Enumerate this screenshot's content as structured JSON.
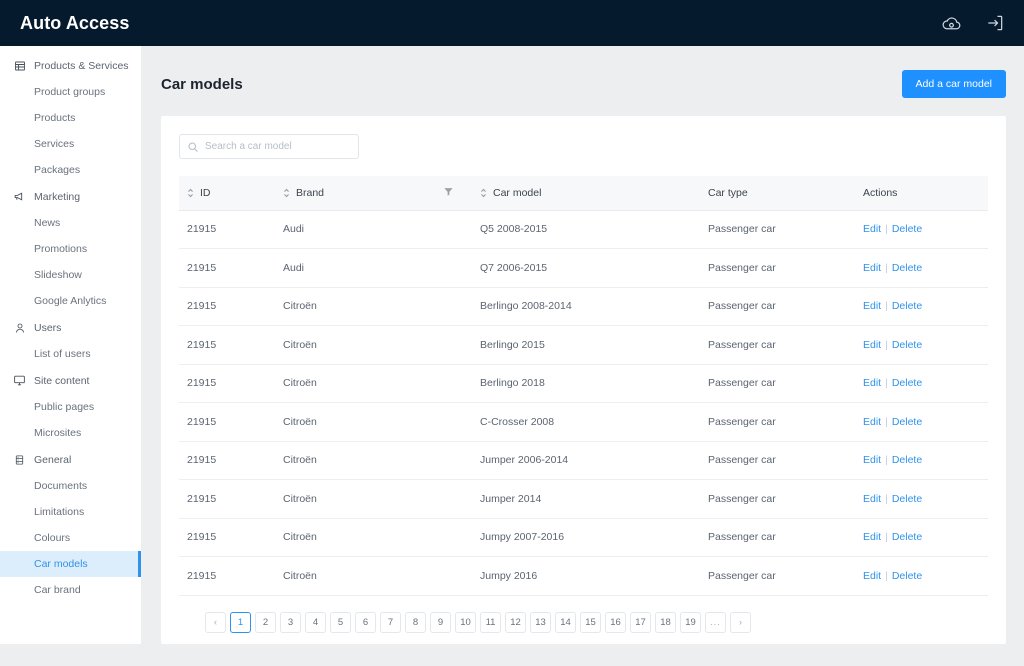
{
  "topbar": {
    "brand": "Auto Access",
    "icons": [
      {
        "name": "cloud-icon",
        "glyph": "cloud"
      },
      {
        "name": "logout-icon",
        "glyph": "logout"
      }
    ]
  },
  "sidebar": {
    "groups": [
      {
        "label": "Products & Services",
        "icon": "grid-table-icon",
        "items": [
          {
            "label": "Product groups",
            "active": false
          },
          {
            "label": "Products",
            "active": false
          },
          {
            "label": "Services",
            "active": false
          },
          {
            "label": "Packages",
            "active": false
          }
        ]
      },
      {
        "label": "Marketing",
        "icon": "megaphone-icon",
        "items": [
          {
            "label": "News",
            "active": false
          },
          {
            "label": "Promotions",
            "active": false
          },
          {
            "label": "Slideshow",
            "active": false
          },
          {
            "label": "Google Anlytics",
            "active": false
          }
        ]
      },
      {
        "label": "Users",
        "icon": "user-icon",
        "items": [
          {
            "label": "List of users",
            "active": false
          }
        ]
      },
      {
        "label": "Site content",
        "icon": "monitor-icon",
        "items": [
          {
            "label": "Public pages",
            "active": false
          },
          {
            "label": "Microsites",
            "active": false
          }
        ]
      },
      {
        "label": "General",
        "icon": "server-icon",
        "items": [
          {
            "label": "Documents",
            "active": false
          },
          {
            "label": "Limitations",
            "active": false
          },
          {
            "label": "Colours",
            "active": false
          },
          {
            "label": "Car models",
            "active": true
          },
          {
            "label": "Car brand",
            "active": false
          }
        ]
      }
    ]
  },
  "main": {
    "page_title": "Car models",
    "add_button": "Add a car model",
    "search": {
      "placeholder": "Search a car model",
      "value": ""
    },
    "table": {
      "columns": [
        {
          "label": "ID",
          "sortable": true,
          "filter": false
        },
        {
          "label": "Brand",
          "sortable": true,
          "filter": true
        },
        {
          "label": "Car model",
          "sortable": true,
          "filter": false
        },
        {
          "label": "Car type",
          "sortable": false,
          "filter": false
        },
        {
          "label": "Actions",
          "sortable": false,
          "filter": false
        }
      ],
      "actions": {
        "edit": "Edit",
        "delete": "Delete",
        "separator": "|"
      },
      "rows": [
        {
          "id": "21915",
          "brand": "Audi",
          "model": "Q5 2008-2015",
          "type": "Passenger car"
        },
        {
          "id": "21915",
          "brand": "Audi",
          "model": "Q7 2006-2015",
          "type": "Passenger car"
        },
        {
          "id": "21915",
          "brand": "Citroën",
          "model": "Berlingo 2008-2014",
          "type": "Passenger car"
        },
        {
          "id": "21915",
          "brand": "Citroën",
          "model": "Berlingo 2015",
          "type": "Passenger car"
        },
        {
          "id": "21915",
          "brand": "Citroën",
          "model": "Berlingo 2018",
          "type": "Passenger car"
        },
        {
          "id": "21915",
          "brand": "Citroën",
          "model": "C-Crosser 2008",
          "type": "Passenger car"
        },
        {
          "id": "21915",
          "brand": "Citroën",
          "model": "Jumper 2006-2014",
          "type": "Passenger car"
        },
        {
          "id": "21915",
          "brand": "Citroën",
          "model": "Jumper 2014",
          "type": "Passenger car"
        },
        {
          "id": "21915",
          "brand": "Citroën",
          "model": "Jumpy 2007-2016",
          "type": "Passenger car"
        },
        {
          "id": "21915",
          "brand": "Citroën",
          "model": "Jumpy 2016",
          "type": "Passenger car"
        }
      ]
    },
    "pagination": {
      "prev": "‹",
      "next": "›",
      "ellipsis": "...",
      "current": "1",
      "pages": [
        "1",
        "2",
        "3",
        "4",
        "5",
        "6",
        "7",
        "8",
        "9",
        "10",
        "11",
        "12",
        "13",
        "14",
        "15",
        "16",
        "17",
        "18",
        "19"
      ]
    }
  },
  "colors": {
    "topbar_bg": "#061a2e",
    "accent": "#1e90ff",
    "link": "#2f93ec",
    "active_nav_bg": "#dcedfb",
    "page_bg": "#eceef0"
  }
}
